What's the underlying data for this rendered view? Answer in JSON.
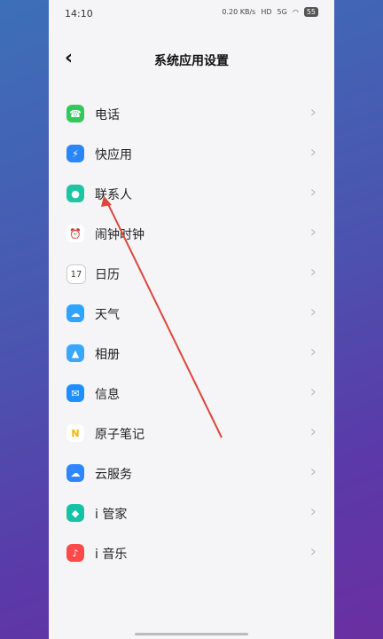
{
  "status": {
    "time": "14:10",
    "net_speed": "0.20 KB/s",
    "hd": "HD",
    "signal": "5G",
    "battery": "55"
  },
  "header": {
    "title": "系统应用设置"
  },
  "list": [
    {
      "label": "电话",
      "icon": "phone-icon",
      "color": "#34c759"
    },
    {
      "label": "快应用",
      "icon": "quick-app-icon",
      "color": "#2a86f6"
    },
    {
      "label": "联系人",
      "icon": "contacts-icon",
      "color": "#1fc4a3"
    },
    {
      "label": "闹钟时钟",
      "icon": "alarm-clock-icon",
      "color": "#ffffff"
    },
    {
      "label": "日历",
      "icon": "calendar-icon",
      "color": "#ffffff"
    },
    {
      "label": "天气",
      "icon": "weather-icon",
      "color": "#2fa4ff"
    },
    {
      "label": "相册",
      "icon": "album-icon",
      "color": "#3aa7ff"
    },
    {
      "label": "信息",
      "icon": "message-icon",
      "color": "#1f8fff"
    },
    {
      "label": "原子笔记",
      "icon": "atom-notes-icon",
      "color": "#ffffff"
    },
    {
      "label": "云服务",
      "icon": "cloud-service-icon",
      "color": "#2f86ff"
    },
    {
      "label": "i 管家",
      "icon": "i-manager-icon",
      "color": "#14c3a6"
    },
    {
      "label": "i 音乐",
      "icon": "i-music-icon",
      "color": "#ff4a4a"
    }
  ],
  "annotation": {
    "color": "#e0453c"
  }
}
